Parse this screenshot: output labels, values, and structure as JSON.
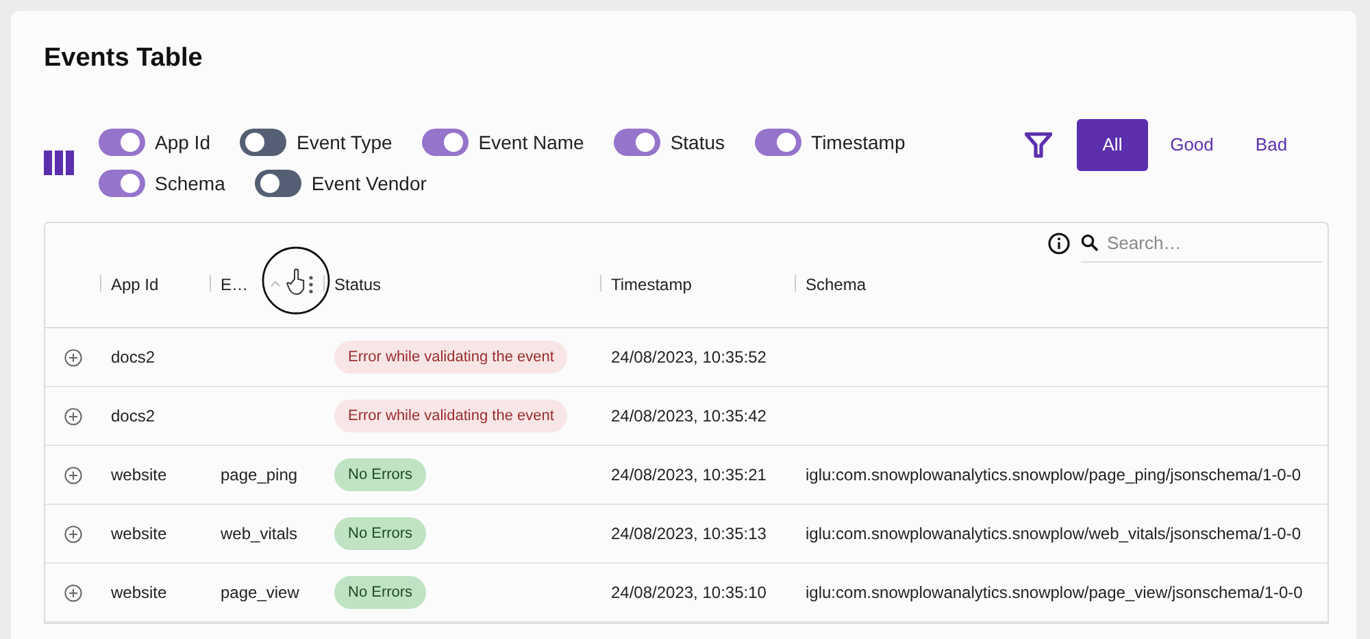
{
  "title": "Events Table",
  "column_toggles": [
    {
      "label": "App Id",
      "on": true
    },
    {
      "label": "Event Type",
      "on": false
    },
    {
      "label": "Event Name",
      "on": true
    },
    {
      "label": "Status",
      "on": true
    },
    {
      "label": "Timestamp",
      "on": true
    },
    {
      "label": "Schema",
      "on": true
    },
    {
      "label": "Event Vendor",
      "on": false
    }
  ],
  "filters": [
    {
      "label": "All",
      "selected": true
    },
    {
      "label": "Good",
      "selected": false
    },
    {
      "label": "Bad",
      "selected": false
    }
  ],
  "search": {
    "placeholder": "Search…"
  },
  "table": {
    "columns": [
      "App Id",
      "E…",
      "Status",
      "Timestamp",
      "Schema"
    ],
    "rows": [
      {
        "app_id": "docs2",
        "event": "",
        "status": {
          "text": "Error while validating the event",
          "kind": "error"
        },
        "timestamp": "24/08/2023, 10:35:52",
        "schema": ""
      },
      {
        "app_id": "docs2",
        "event": "",
        "status": {
          "text": "Error while validating the event",
          "kind": "error"
        },
        "timestamp": "24/08/2023, 10:35:42",
        "schema": ""
      },
      {
        "app_id": "website",
        "event": "page_ping",
        "status": {
          "text": "No Errors",
          "kind": "ok"
        },
        "timestamp": "24/08/2023, 10:35:21",
        "schema": "iglu:com.snowplowanalytics.snowplow/page_ping/jsonschema/1-0-0"
      },
      {
        "app_id": "website",
        "event": "web_vitals",
        "status": {
          "text": "No Errors",
          "kind": "ok"
        },
        "timestamp": "24/08/2023, 10:35:13",
        "schema": "iglu:com.snowplowanalytics.snowplow/web_vitals/jsonschema/1-0-0"
      },
      {
        "app_id": "website",
        "event": "page_view",
        "status": {
          "text": "No Errors",
          "kind": "ok"
        },
        "timestamp": "24/08/2023, 10:35:10",
        "schema": "iglu:com.snowplowanalytics.snowplow/page_view/jsonschema/1-0-0"
      }
    ]
  }
}
